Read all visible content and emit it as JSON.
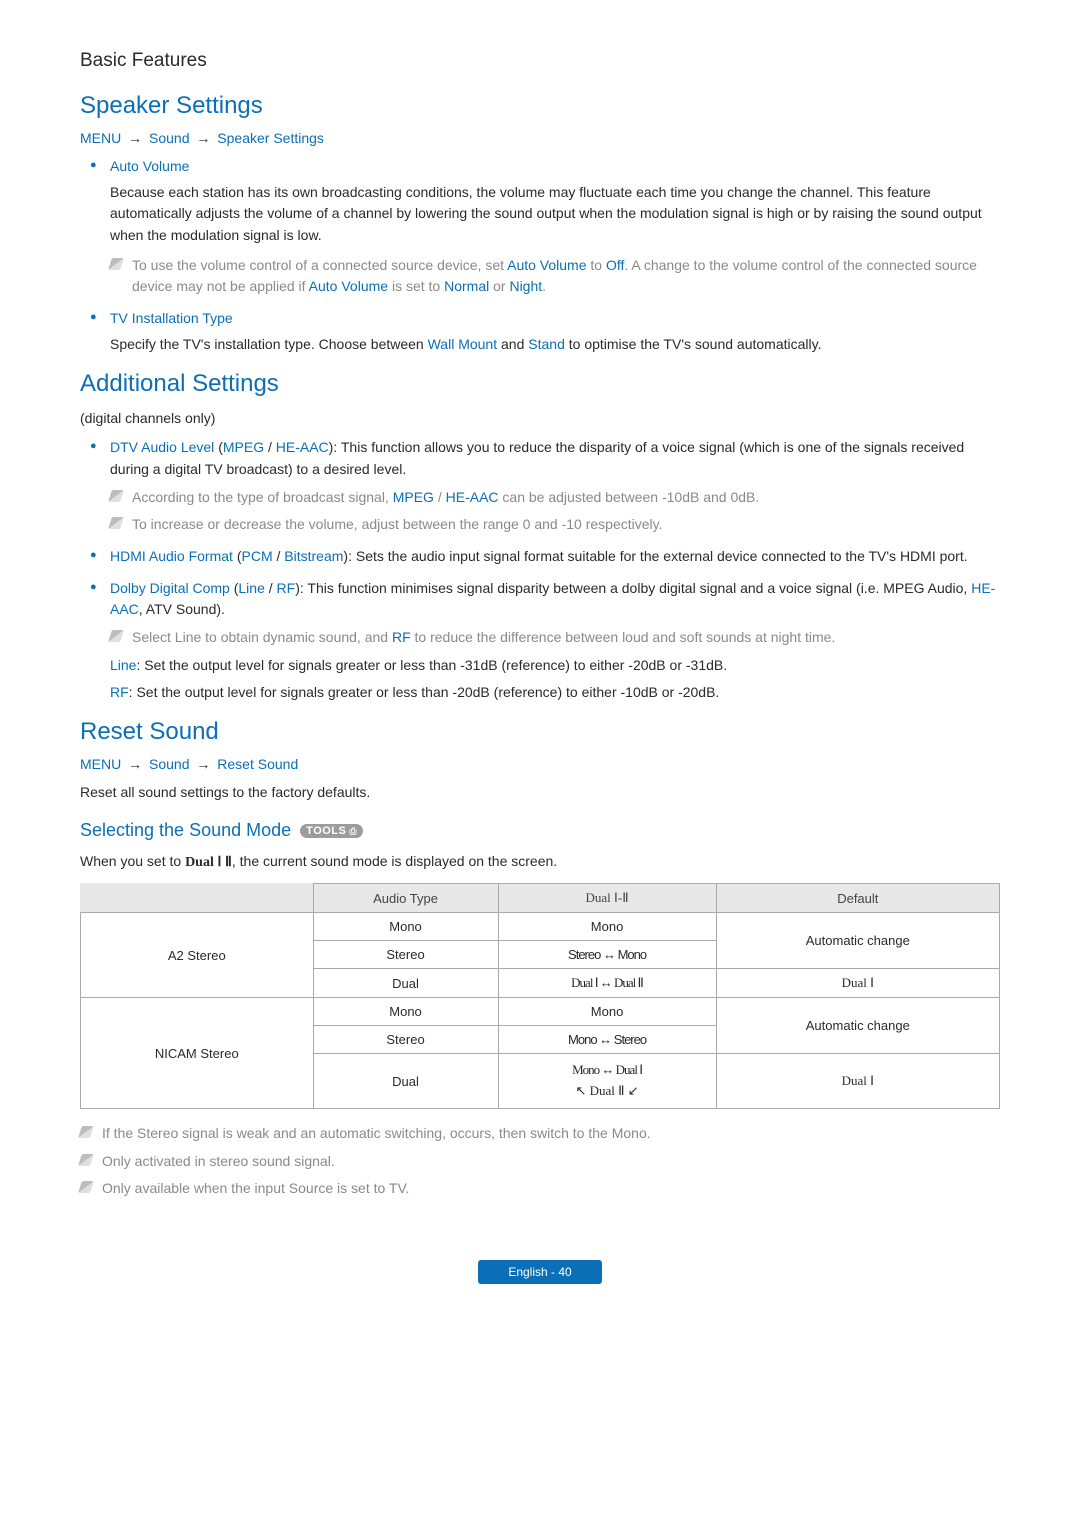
{
  "header": {
    "title": "Basic Features"
  },
  "speaker": {
    "title": "Speaker Settings",
    "breadcrumb": {
      "a": "MENU",
      "b": "Sound",
      "c": "Speaker Settings"
    },
    "items": [
      {
        "term": "Auto Volume",
        "body": "Because each station has its own broadcasting conditions, the volume may fluctuate each time you change the channel. This feature automatically adjusts the volume of a channel by lowering the sound output when the modulation signal is high or by raising the sound output when the modulation signal is low.",
        "note_pre": "To use the volume control of a connected source device, set ",
        "note_t1": "Auto Volume",
        "note_mid1": " to ",
        "note_t2": "Off",
        "note_mid2": ". A change to the volume control of the connected source device may not be applied if ",
        "note_t3": "Auto Volume",
        "note_mid3": " is set to ",
        "note_t4": "Normal",
        "note_mid4": " or ",
        "note_t5": "Night",
        "note_end": "."
      },
      {
        "term": "TV Installation Type",
        "body_pre": "Specify the TV's installation type. Choose between ",
        "body_t1": "Wall Mount",
        "body_mid": " and ",
        "body_t2": "Stand",
        "body_end": " to optimise the TV's sound automatically."
      }
    ]
  },
  "additional": {
    "title": "Additional Settings",
    "subtitle": "(digital channels only)",
    "items": [
      {
        "term": "DTV Audio Level",
        "paren_a": "MPEG",
        "paren_b": "HE-AAC",
        "body": "This function allows you to reduce the disparity of a voice signal (which is one of the signals received during a digital TV broadcast) to a desired level.",
        "note1_pre": "According to the type of broadcast signal, ",
        "note1_t1": "MPEG",
        "note1_mid": " / ",
        "note1_t2": "HE-AAC",
        "note1_end": " can be adjusted between -10dB and 0dB.",
        "note2": "To increase or decrease the volume, adjust between the range 0 and -10 respectively."
      },
      {
        "term": "HDMI Audio Format",
        "paren_a": "PCM",
        "paren_b": "Bitstream",
        "body": "Sets the audio input signal format suitable for the external device connected to the TV's HDMI port."
      },
      {
        "term": "Dolby Digital Comp",
        "paren_a": "Line",
        "paren_b": "RF",
        "body_pre": "This function minimises signal disparity between a dolby digital signal and a voice signal (i.e. MPEG Audio, ",
        "body_t1": "HE-AAC",
        "body_end": ", ATV Sound).",
        "note_pre": "Select Line to obtain dynamic sound, and ",
        "note_t1": "RF",
        "note_end": " to reduce the difference between loud and soft sounds at night time.",
        "line_label": "Line",
        "line_body": ": Set the output level for signals greater or less than -31dB (reference) to either -20dB or -31dB.",
        "rf_label": "RF",
        "rf_body": ": Set the output level for signals greater or less than -20dB (reference) to either -10dB or -20dB."
      }
    ]
  },
  "reset": {
    "title": "Reset Sound",
    "breadcrumb": {
      "a": "MENU",
      "b": "Sound",
      "c": "Reset Sound"
    },
    "body": "Reset all sound settings to the factory defaults."
  },
  "selecting": {
    "title": "Selecting the Sound Mode",
    "tools_label": "TOOLS",
    "intro_pre": "When you set to ",
    "intro_bold": "Dual Ⅰ Ⅱ",
    "intro_end": ", the current sound mode is displayed on the screen."
  },
  "table": {
    "headers": {
      "h1": "Audio Type",
      "h2": "Dual Ⅰ-Ⅱ",
      "h3": "Default"
    },
    "rows": {
      "a2_label": "A2 Stereo",
      "a2_mono_type": "Mono",
      "a2_mono_dual": "Mono",
      "a2_stereo_type": "Stereo",
      "a2_stereo_dual": "Stereo ↔ Mono",
      "a2_default": "Automatic change",
      "a2_dual_type": "Dual",
      "a2_dual_dual": "Dual Ⅰ ↔ Dual Ⅱ",
      "a2_dual_default": "Dual Ⅰ",
      "nicam_label": "NICAM Stereo",
      "nicam_mono_type": "Mono",
      "nicam_mono_dual": "Mono",
      "nicam_stereo_type": "Stereo",
      "nicam_stereo_dual": "Mono ↔ Stereo",
      "nicam_ms_default": "Automatic change",
      "nicam_dual_type": "Dual",
      "nicam_dual_dual_l1": "Mono ↔ Dual Ⅰ",
      "nicam_dual_dual_l2": "↖ Dual Ⅱ ↙",
      "nicam_dual_default": "Dual Ⅰ"
    }
  },
  "footer_notes": {
    "n1": "If the Stereo signal is weak and an automatic switching, occurs, then switch to the Mono.",
    "n2": "Only activated in stereo sound signal.",
    "n3": "Only available when the input Source is set to TV."
  },
  "footer": {
    "label": "English - 40"
  }
}
